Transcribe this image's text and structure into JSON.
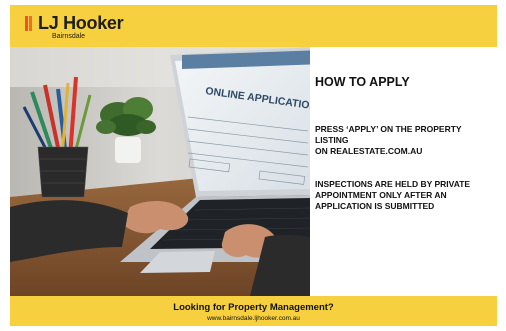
{
  "brand": {
    "name": "LJ Hooker",
    "office": "Bairnsdale",
    "accent_color": "#f6d03f",
    "logo_bar_color": "#e8542c"
  },
  "photo": {
    "screen_heading": "ONLINE APPLICATION",
    "icons": [
      "pencil-cup-icon",
      "plant-icon",
      "laptop-icon"
    ]
  },
  "info": {
    "title": "HOW TO APPLY",
    "step1_line1": "PRESS ‘APPLY’ ON THE PROPERTY LISTING",
    "step1_line2": "ON REALESTATE.COM.AU",
    "step2": "INSPECTIONS ARE HELD BY PRIVATE APPOINTMENT ONLY AFTER AN APPLICATION IS SUBMITTED"
  },
  "footer": {
    "title": "Looking for Property Management?",
    "url": "www.bairnsdale.ljhooker.com.au"
  }
}
